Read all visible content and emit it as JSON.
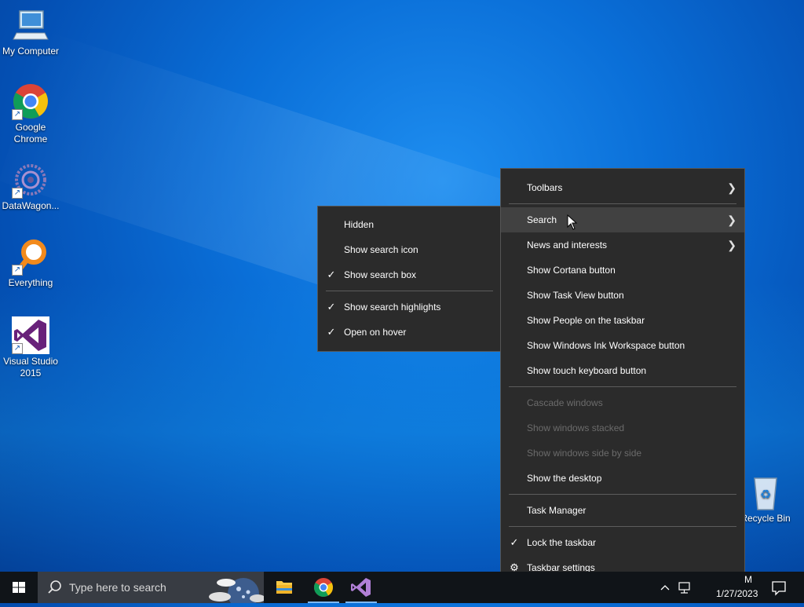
{
  "desktop": {
    "icons": [
      {
        "label": "My Computer",
        "icon": "computer-icon"
      },
      {
        "label": "Google Chrome",
        "icon": "chrome-icon"
      },
      {
        "label": "DataWagon...",
        "icon": "datawagon-icon"
      },
      {
        "label": "Everything",
        "icon": "everything-icon"
      },
      {
        "label": "Visual Studio 2015",
        "icon": "visual-studio-icon"
      },
      {
        "label": "Recycle Bin",
        "icon": "recycle-bin-icon"
      }
    ]
  },
  "context_menu": {
    "items": {
      "toolbars": "Toolbars",
      "search": "Search",
      "news": "News and interests",
      "cortana": "Show Cortana button",
      "task_view": "Show Task View button",
      "people": "Show People on the taskbar",
      "ink": "Show Windows Ink Workspace button",
      "keyboard": "Show touch keyboard button",
      "cascade": "Cascade windows",
      "stacked": "Show windows stacked",
      "side_by_side": "Show windows side by side",
      "show_desktop": "Show the desktop",
      "task_manager": "Task Manager",
      "lock": "Lock the taskbar",
      "settings": "Taskbar settings"
    },
    "checked": {
      "lock": true
    },
    "disabled": [
      "cascade",
      "stacked",
      "side_by_side"
    ]
  },
  "search_submenu": {
    "items": {
      "hidden": "Hidden",
      "show_icon": "Show search icon",
      "show_box": "Show search box",
      "highlights": "Show search highlights",
      "hover": "Open on hover"
    },
    "checked": {
      "show_box": true,
      "highlights": true,
      "hover": true
    }
  },
  "taskbar": {
    "search_placeholder": "Type here to search",
    "apps": [
      "file-explorer-icon",
      "chrome-icon",
      "visual-studio-icon"
    ],
    "clock_time_fragment": "M",
    "clock_date": "1/27/2023"
  },
  "colors": {
    "menu_bg": "#2b2b2b",
    "menu_hover": "#414141",
    "taskbar_bg": "#101418",
    "accent": "#0a6fd8"
  }
}
